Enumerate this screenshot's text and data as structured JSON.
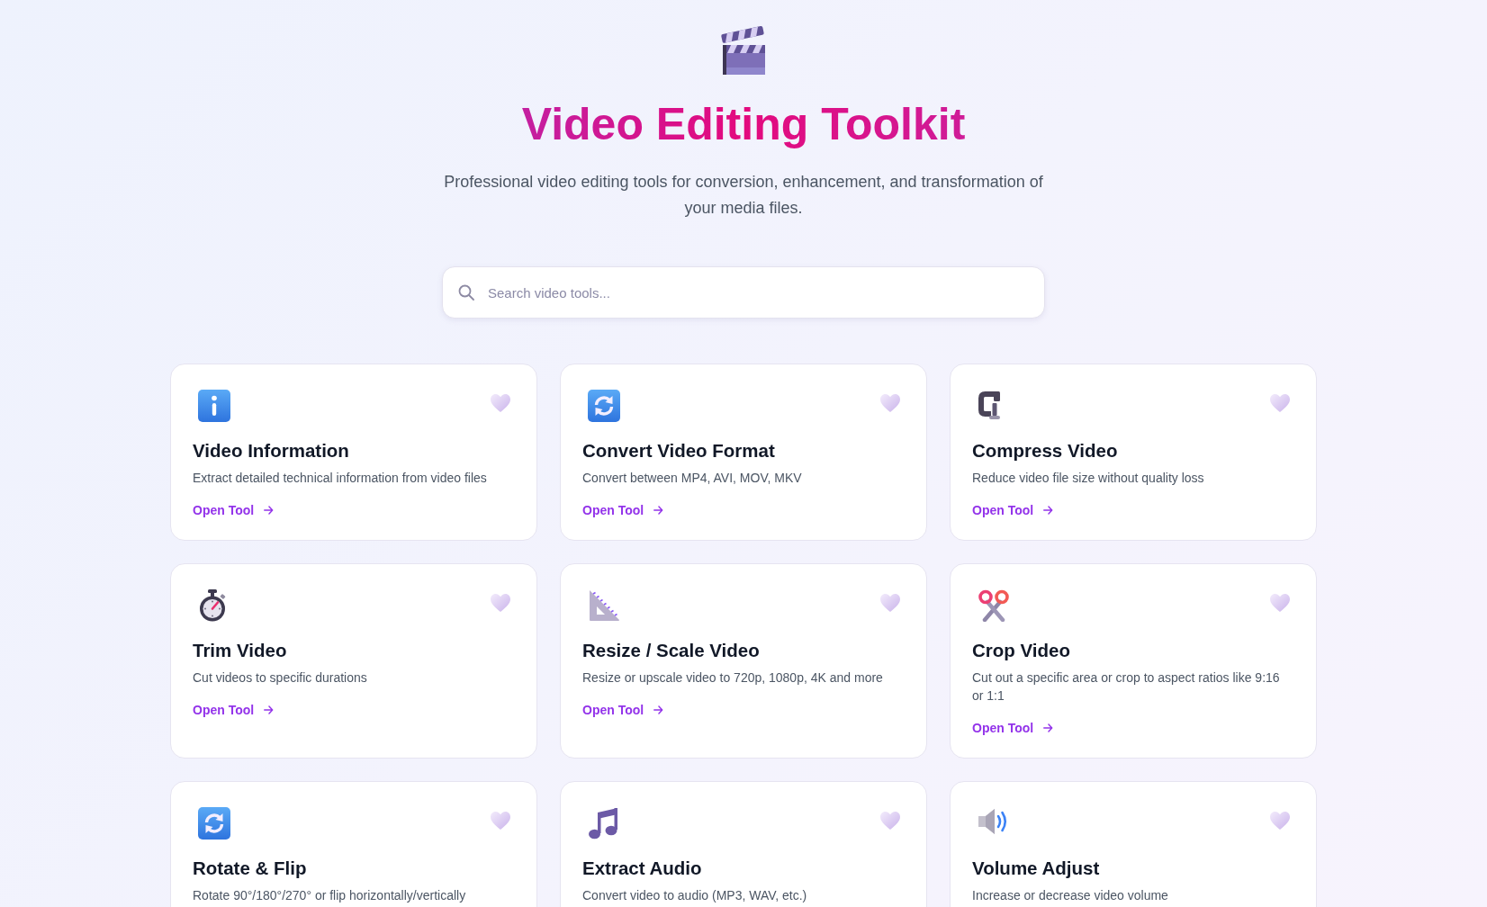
{
  "header": {
    "title": "Video Editing Toolkit",
    "subtitle": "Professional video editing tools for conversion, enhancement, and transformation of your media files."
  },
  "search": {
    "placeholder": "Search video tools..."
  },
  "cards": [
    {
      "title": "Video Information",
      "description": "Extract detailed technical information from video files",
      "link": "Open Tool",
      "favorite": false
    },
    {
      "title": "Convert Video Format",
      "description": "Convert between MP4, AVI, MOV, MKV",
      "link": "Open Tool",
      "favorite": false
    },
    {
      "title": "Compress Video",
      "description": "Reduce video file size without quality loss",
      "link": "Open Tool",
      "favorite": false
    },
    {
      "title": "Trim Video",
      "description": "Cut videos to specific durations",
      "link": "Open Tool",
      "favorite": false
    },
    {
      "title": "Resize / Scale Video",
      "description": "Resize or upscale video to 720p, 1080p, 4K and more",
      "link": "Open Tool",
      "favorite": false
    },
    {
      "title": "Crop Video",
      "description": "Cut out a specific area or crop to aspect ratios like 9:16 or 1:1",
      "link": "Open Tool",
      "favorite": false
    },
    {
      "title": "Rotate & Flip",
      "description": "Rotate 90°/180°/270° or flip horizontally/vertically",
      "favorite": false
    },
    {
      "title": "Extract Audio",
      "description": "Convert video to audio (MP3, WAV, etc.)",
      "favorite": false
    },
    {
      "title": "Volume Adjust",
      "description": "Increase or decrease video volume",
      "favorite": false
    }
  ]
}
